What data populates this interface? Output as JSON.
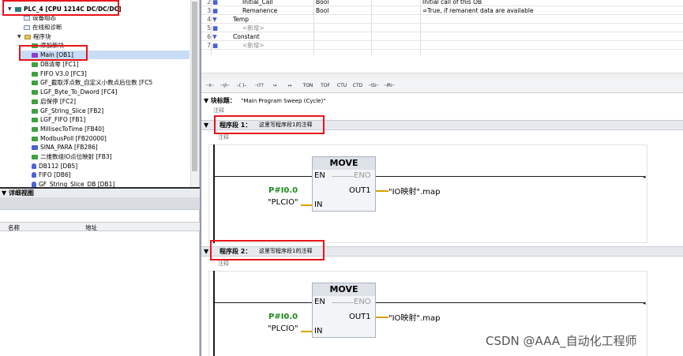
{
  "tree": {
    "root_label": "PLC_4 [CPU 1214C DC/DC/DC]",
    "items": [
      {
        "label": "设备组态",
        "icon": "device-config-icon"
      },
      {
        "label": "在线和诊断",
        "icon": "online-diag-icon"
      },
      {
        "label": "程序块",
        "icon": "folder-icon"
      },
      {
        "label": "添加新块",
        "icon": "add-block-icon"
      },
      {
        "label": "Main [OB1]",
        "icon": "ob-block-icon"
      },
      {
        "label": "DB清零 [FC1]",
        "icon": "fc-block-icon"
      },
      {
        "label": "FIFO V3.0 [FC3]",
        "icon": "fc-block-icon"
      },
      {
        "label": "GF_截取浮点数_自定义小数点后位数 [FC5",
        "icon": "fc-block-icon"
      },
      {
        "label": "LGF_Byte_To_Dword [FC4]",
        "icon": "fc-block-icon"
      },
      {
        "label": "启保停 [FC2]",
        "icon": "fc-block-icon"
      },
      {
        "label": "GF_String_Slice [FB2]",
        "icon": "fb-block-icon"
      },
      {
        "label": "LGF_FIFO [FB1]",
        "icon": "fb-block-icon"
      },
      {
        "label": "MillisecToTime [FB40]",
        "icon": "fb-block-icon"
      },
      {
        "label": "ModbusPoll [FB20000]",
        "icon": "fb-block-icon"
      },
      {
        "label": "SINA_PARA [FB286]",
        "icon": "fb-block-icon"
      },
      {
        "label": "二维数组IO点位映射 [FB3]",
        "icon": "fb-block-icon"
      },
      {
        "label": "DB112 [DB5]",
        "icon": "db-block-icon"
      },
      {
        "label": "FIFO [DB6]",
        "icon": "db-block-icon"
      },
      {
        "label": "GF_String_Slice_DB [DB1]",
        "icon": "db-block-icon"
      }
    ]
  },
  "detail_view": {
    "title": "详细视图",
    "col_name": "名称",
    "col_address": "地址"
  },
  "interface": {
    "rows": [
      {
        "num": "2",
        "name": "Initial_Call",
        "type": "Bool",
        "comment": "Initial call of this OB"
      },
      {
        "num": "3",
        "name": "Remanence",
        "type": "Bool",
        "comment": "=True, if remanent data are available"
      },
      {
        "num": "4",
        "name": "Temp",
        "type": "",
        "comment": ""
      },
      {
        "num": "5",
        "name": "<新增>",
        "type": "",
        "comment": ""
      },
      {
        "num": "6",
        "name": "Constant",
        "type": "",
        "comment": ""
      },
      {
        "num": "7",
        "name": "<新增>",
        "type": "",
        "comment": ""
      }
    ]
  },
  "toolbar": {
    "buttons": [
      "⊣⊢",
      "⊣/⊢",
      "–( )–",
      "⊣??",
      "↪",
      "↦",
      "TON",
      "TOF",
      "CTU",
      "CTD",
      "⊣S⊢",
      "⊣R⊢"
    ]
  },
  "block_title": {
    "label": "块标题：",
    "value": "\"Main Program Sweep (Cycle)\"",
    "comment": "注释"
  },
  "networks": [
    {
      "label": "程序段 1：",
      "title": "这里写程序段1的注释",
      "comment": "注释",
      "box": {
        "name": "MOVE",
        "en": "EN",
        "eno": "ENO",
        "in": "IN",
        "out1": "OUT1"
      },
      "in_value": "P#I0.0",
      "in_operand": "\"PLCIO\"",
      "out_operand": "\"IO映射\".map"
    },
    {
      "label": "程序段 2：",
      "title": "这里写程序段1的注释",
      "comment": "注释",
      "box": {
        "name": "MOVE",
        "en": "EN",
        "eno": "ENO",
        "in": "IN",
        "out1": "OUT1"
      },
      "in_value": "P#I0.0",
      "in_operand": "\"PLCIO\"",
      "out_operand": "\"IO映射\".map"
    }
  ],
  "watermark": "CSDN @AAA_自动化工程师",
  "colors": {
    "highlight_red": "#e8141b",
    "wire_yellow": "#d8a200",
    "constant_green": "#1c8a1c",
    "selection_blue": "#c9dcf5"
  }
}
